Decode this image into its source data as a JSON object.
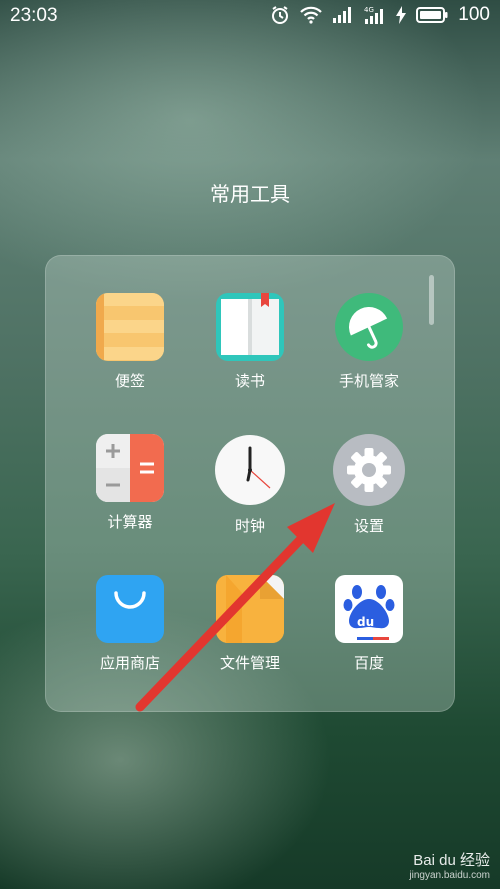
{
  "status_bar": {
    "time": "23:03",
    "battery_text": "100",
    "icons": [
      "alarm-icon",
      "wifi-icon",
      "signal-icon",
      "4g-signal-icon",
      "charging-icon",
      "battery-icon"
    ]
  },
  "folder": {
    "title": "常用工具",
    "apps": [
      {
        "label": "便签",
        "icon": "notes-icon"
      },
      {
        "label": "读书",
        "icon": "book-icon"
      },
      {
        "label": "手机管家",
        "icon": "umbrella-icon"
      },
      {
        "label": "计算器",
        "icon": "calculator-icon"
      },
      {
        "label": "时钟",
        "icon": "clock-icon"
      },
      {
        "label": "设置",
        "icon": "gear-icon"
      },
      {
        "label": "应用商店",
        "icon": "shopping-bag-icon"
      },
      {
        "label": "文件管理",
        "icon": "folder-icon"
      },
      {
        "label": "百度",
        "icon": "baidu-paw-icon"
      }
    ]
  },
  "watermark": {
    "text": "Bai du 经验",
    "sub": "jingyan.baidu.com"
  },
  "colors": {
    "annotation_arrow": "#e2362f",
    "manager_green": "#3fba7b",
    "store_blue": "#2fa4f2",
    "files_orange": "#f8b23e",
    "notes_yellow": "#f8c66f"
  }
}
